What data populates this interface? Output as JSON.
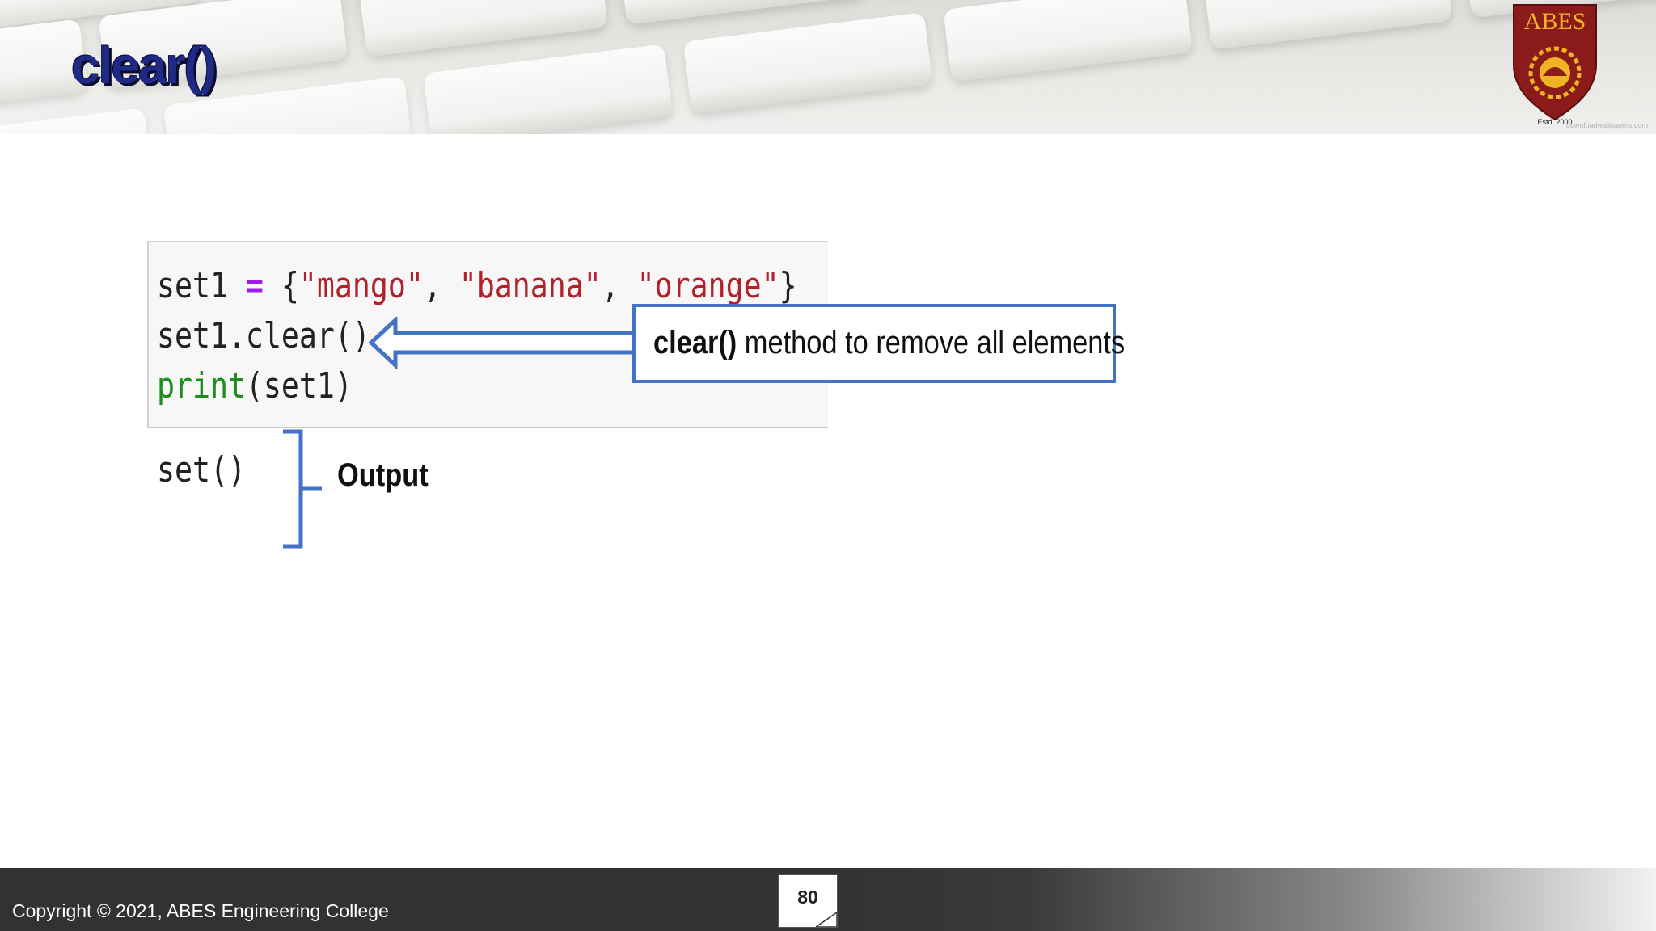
{
  "slide": {
    "title": "clear()",
    "watermark": "downloadwallpapers.com",
    "logo": {
      "text": "ABES",
      "est": "Estd. 2000"
    }
  },
  "code": {
    "line1": {
      "var": "set1 ",
      "op": "=",
      "open": " {",
      "s1": "\"mango\"",
      "sep1": ", ",
      "s2": "\"banana\"",
      "sep2": ", ",
      "s3": "\"orange\"",
      "close": "}"
    },
    "line2": "set1.clear()",
    "line3": {
      "fn": "print",
      "rest": "(set1)"
    }
  },
  "callout": {
    "bold": "clear()",
    "text": " method to remove all elements"
  },
  "output": {
    "code": "set()",
    "label": "Output"
  },
  "footer": {
    "copyright": "Copyright © 2021, ABES Engineering College",
    "page_number": "80"
  },
  "colors": {
    "title": "#1f2a86",
    "accent": "#4472c4",
    "string": "#b3202a",
    "operator": "#a21aed",
    "builtin": "#1e8c1e",
    "logo_red": "#8b1a1a",
    "logo_gold": "#f0b323"
  }
}
